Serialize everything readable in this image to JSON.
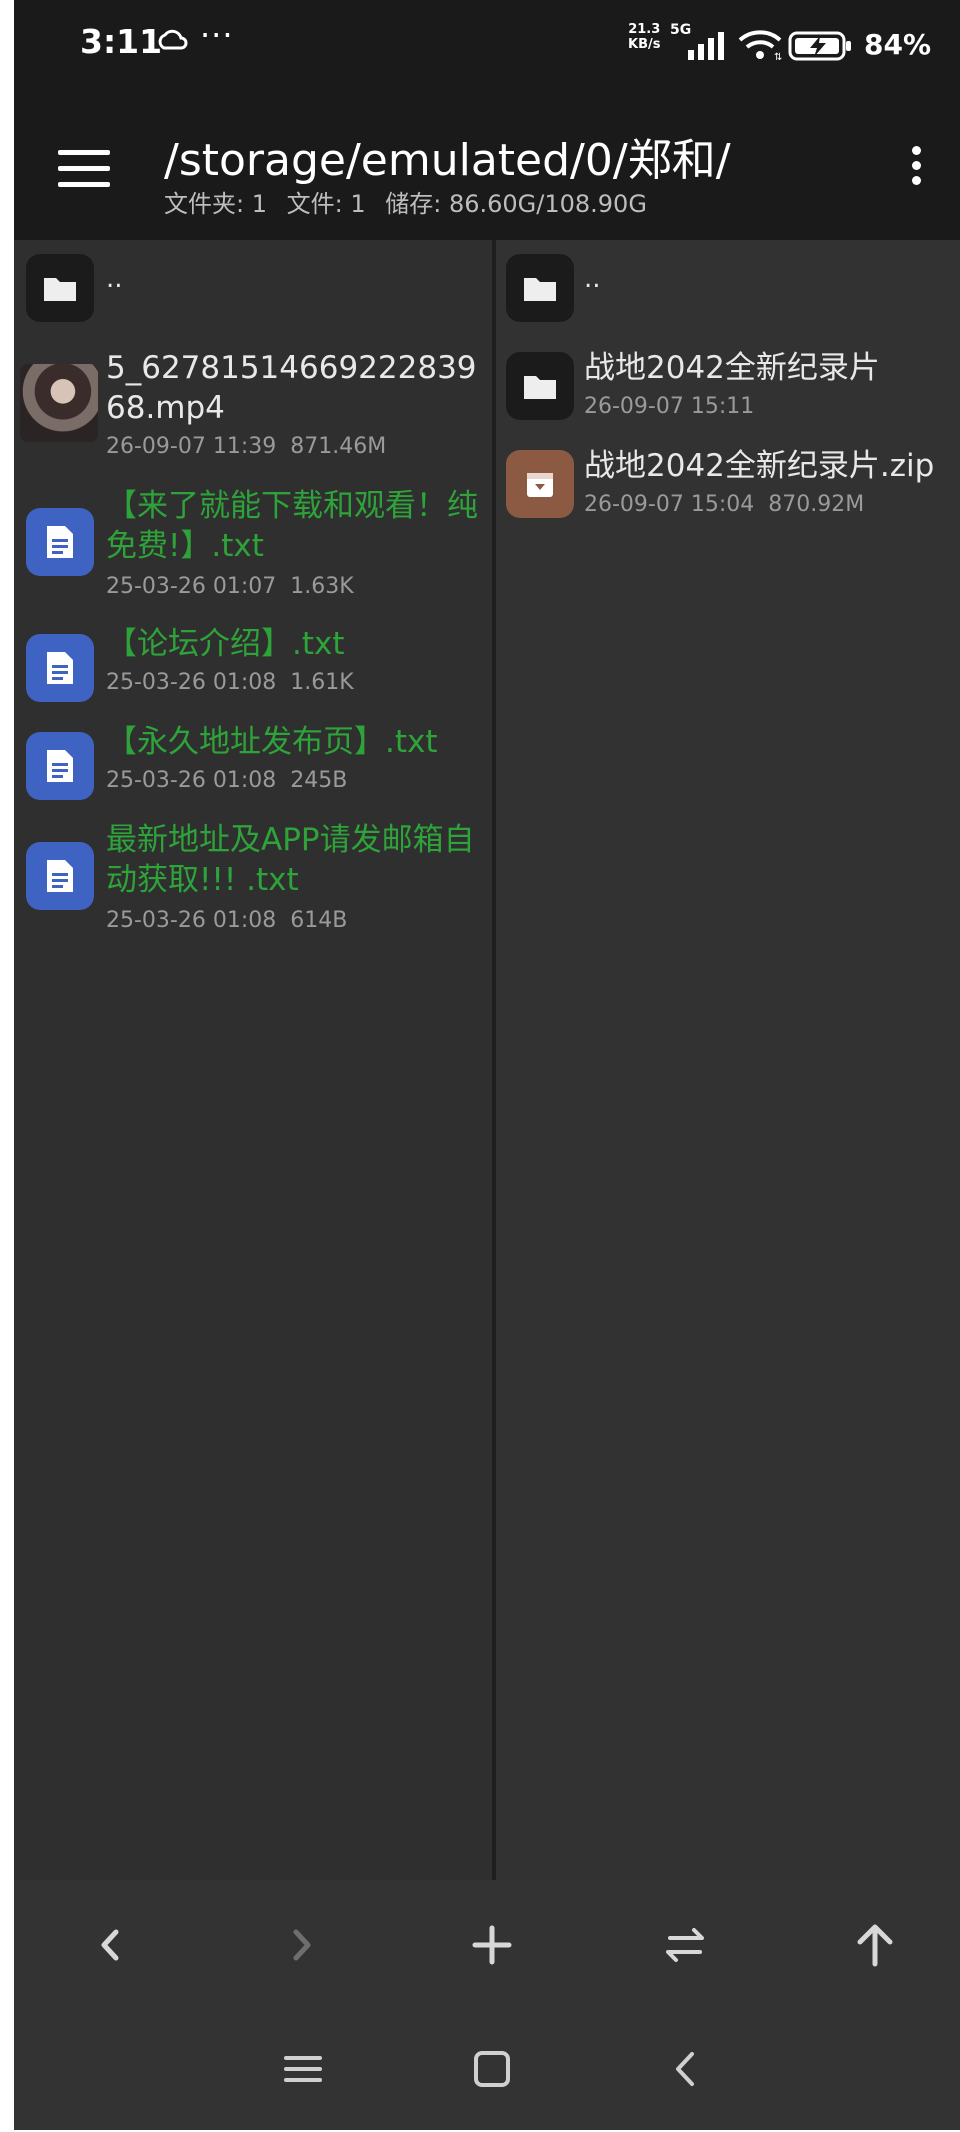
{
  "status_bar": {
    "time": "3:11",
    "network_speed_value": "21.3",
    "network_speed_unit": "KB/s",
    "network_type": "5G",
    "battery_percent": "84%",
    "icons": [
      "cloud-icon",
      "more-notifications-icon",
      "signal-icon",
      "wifi-icon",
      "battery-charging-icon"
    ]
  },
  "toolbar": {
    "path": "/storage/emulated/0/郑和/",
    "folders_label": "文件夹: 1",
    "files_label": "文件: 1",
    "storage_label": "储存: 86.60G/108.90G"
  },
  "left_pane": {
    "parent_label": "..",
    "files": [
      {
        "name": "5_6278151466922283968.mp4",
        "date": "26-09-07 11:39",
        "size": "871.46M",
        "type": "video"
      },
      {
        "name": "【来了就能下载和观看！纯免费!】.txt",
        "date": "25-03-26 01:07",
        "size": "1.63K",
        "type": "text"
      },
      {
        "name": "【论坛介绍】.txt",
        "date": "25-03-26 01:08",
        "size": "1.61K",
        "type": "text"
      },
      {
        "name": "【永久地址发布页】.txt",
        "date": "25-03-26 01:08",
        "size": "245B",
        "type": "text"
      },
      {
        "name": "最新地址及APP请发邮箱自动获取!!! .txt",
        "date": "25-03-26 01:08",
        "size": "614B",
        "type": "text"
      }
    ]
  },
  "right_pane": {
    "parent_label": "..",
    "files": [
      {
        "name": "战地2042全新纪录片",
        "date": "26-09-07 15:11",
        "size": "",
        "type": "folder"
      },
      {
        "name": "战地2042全新纪录片.zip",
        "date": "26-09-07 15:04",
        "size": "870.92M",
        "type": "archive"
      }
    ]
  },
  "action_bar": {
    "icons": [
      "back-arrow-icon",
      "forward-arrow-icon",
      "add-icon",
      "swap-panes-icon",
      "up-arrow-icon"
    ]
  },
  "nav_bar": {
    "icons": [
      "recent-apps-icon",
      "home-icon",
      "system-back-icon"
    ]
  },
  "colors": {
    "background": "#2f2f2f",
    "toolbar": "#1a1a1a",
    "text_file_green": "#2ea33a",
    "doc_icon_blue": "#3f63c2",
    "zip_icon_brown": "#8c5a43"
  }
}
